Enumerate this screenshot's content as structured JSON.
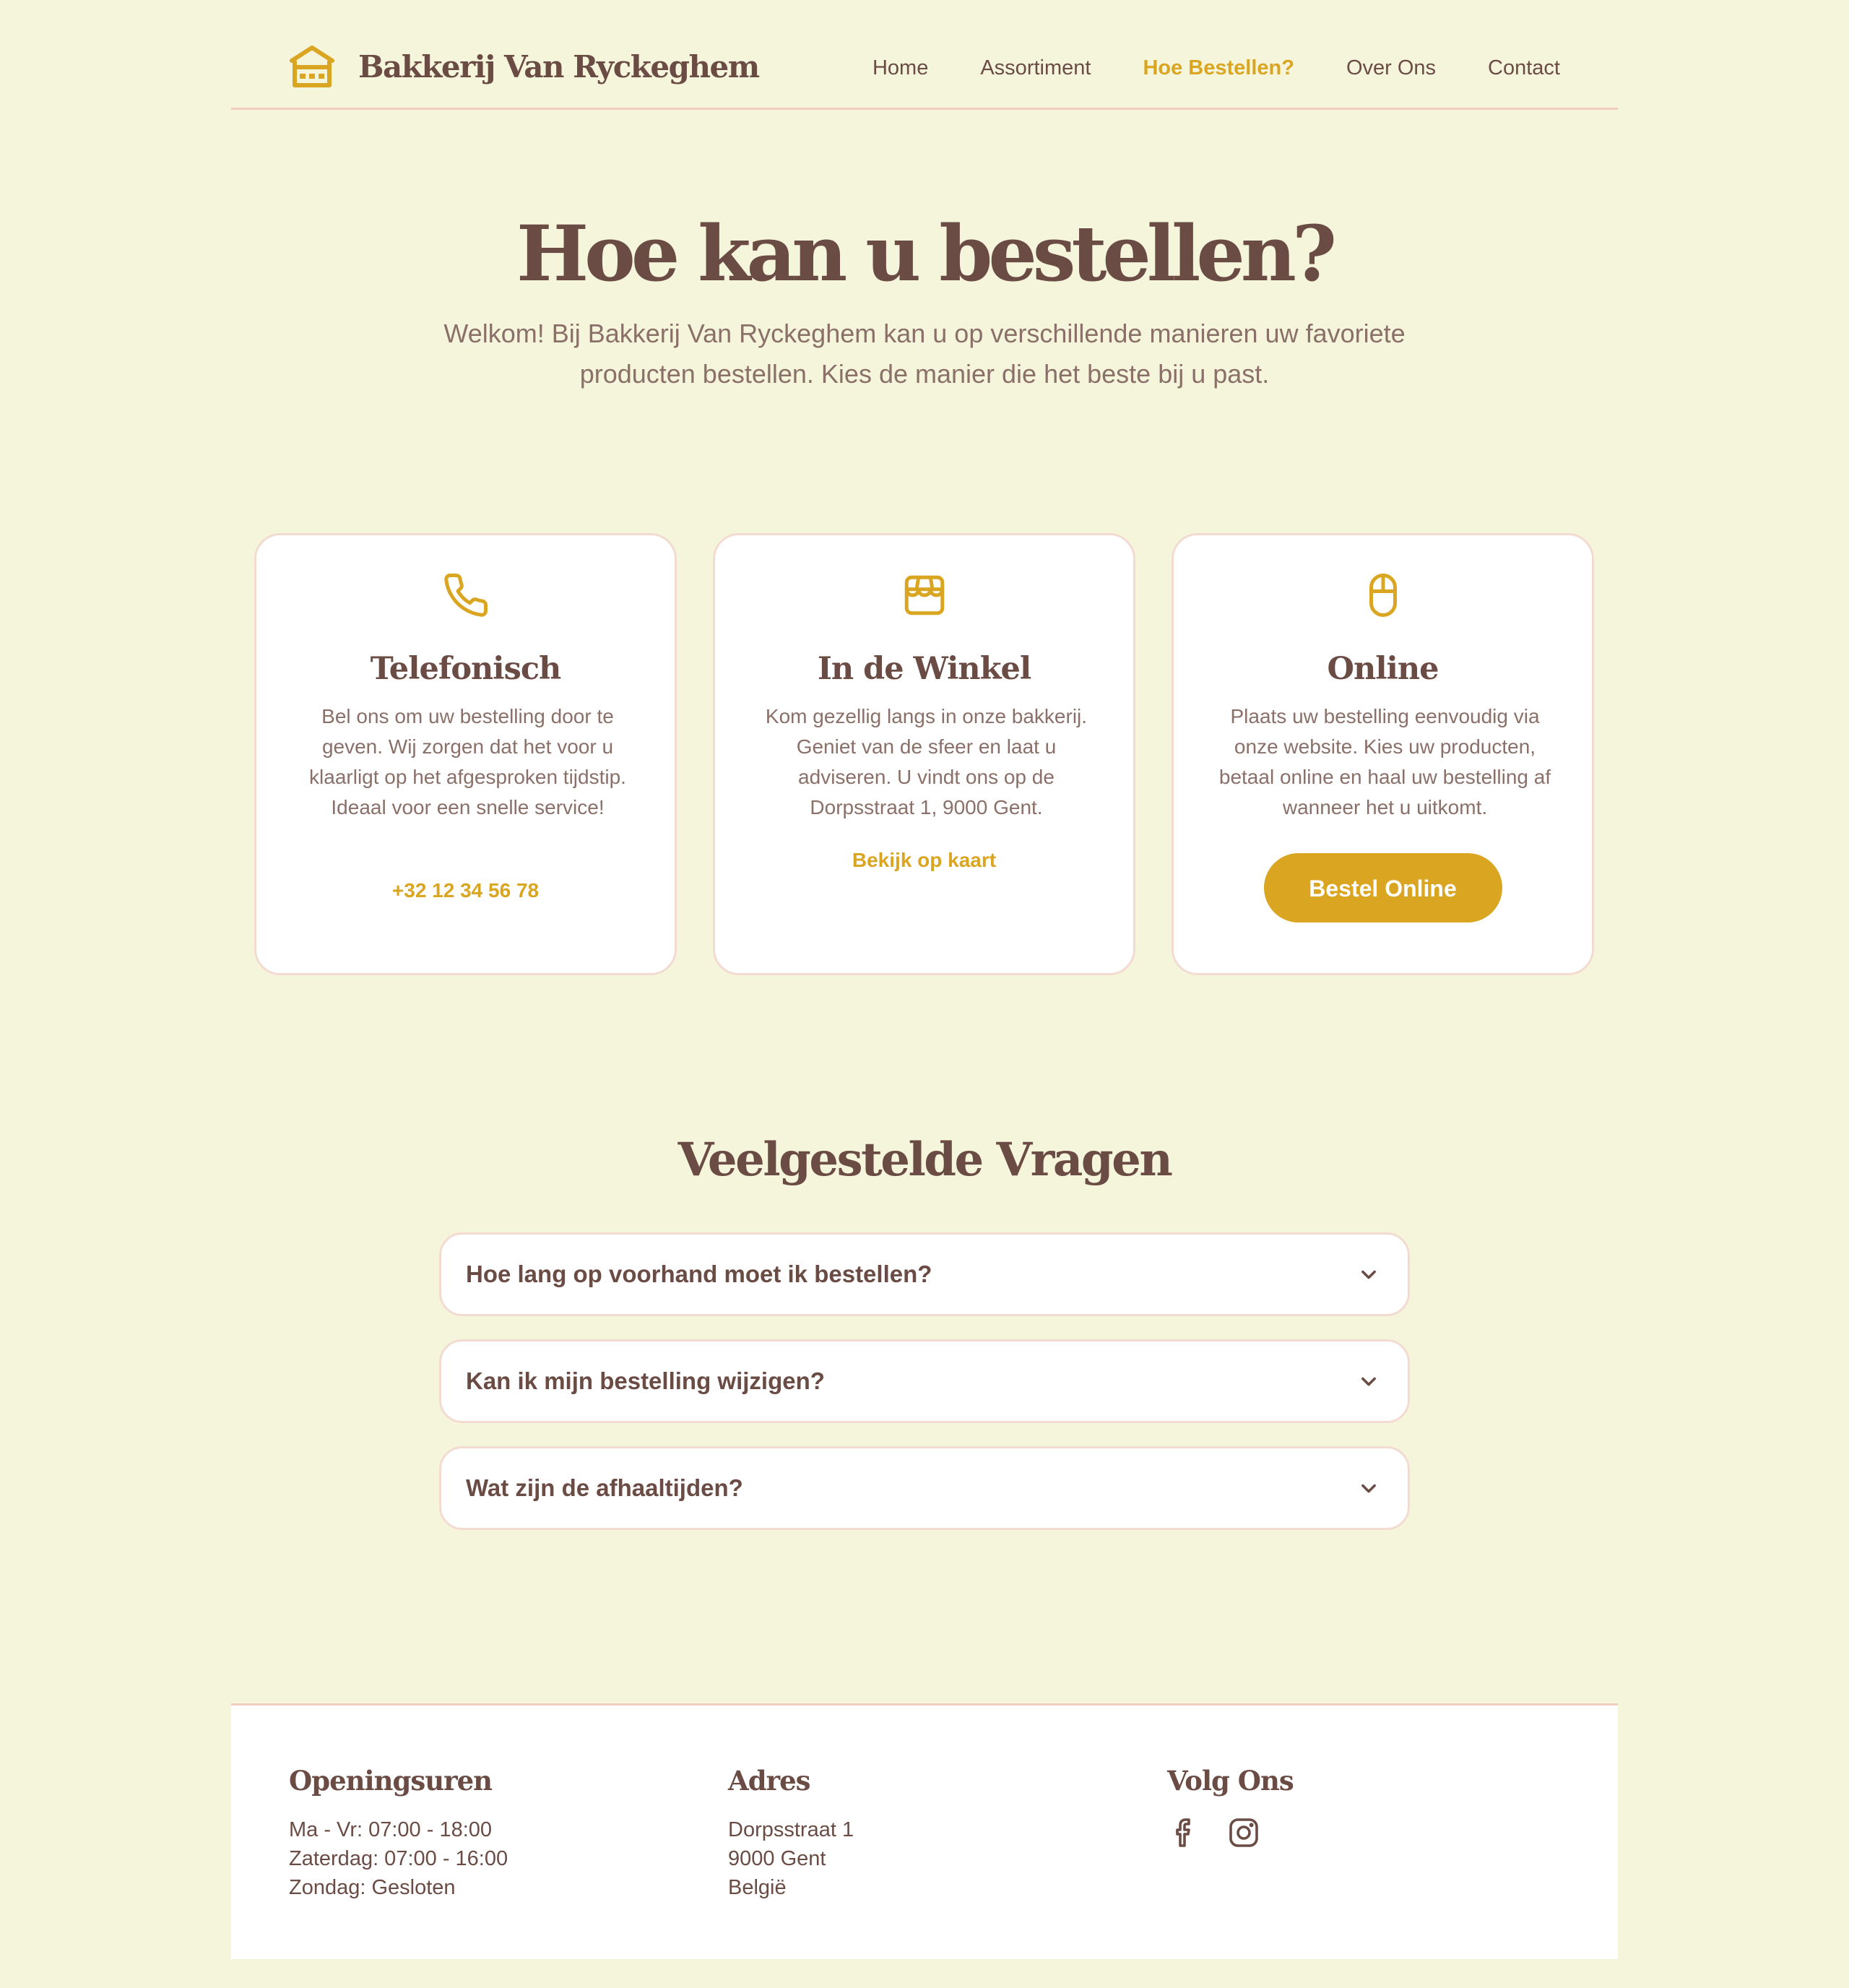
{
  "brand": {
    "name": "Bakkerij Van Ryckeghem",
    "icon": "bakery-store-icon",
    "accent_color": "#daa520",
    "text_color": "#6b4c45",
    "background_color": "#f5f5dc"
  },
  "nav": {
    "items": [
      {
        "label": "Home",
        "active": false
      },
      {
        "label": "Assortiment",
        "active": false
      },
      {
        "label": "Hoe Bestellen?",
        "active": true
      },
      {
        "label": "Over Ons",
        "active": false
      },
      {
        "label": "Contact",
        "active": false
      }
    ]
  },
  "hero": {
    "title": "Hoe kan u bestellen?",
    "subtitle": "Welkom! Bij Bakkerij Van Ryckeghem kan u op verschillende manieren uw favoriete producten bestellen. Kies de manier die het beste bij u past."
  },
  "cards": [
    {
      "icon": "phone-icon",
      "title": "Telefonisch",
      "text": "Bel ons om uw bestelling door te geven. Wij zorgen dat het voor u klaarligt op het afgesproken tijdstip. Ideaal voor een snelle service!",
      "link": "+32 12 34 56 78"
    },
    {
      "icon": "store-icon",
      "title": "In de Winkel",
      "text": "Kom gezellig langs in onze bakkerij. Geniet van de sfeer en laat u adviseren. U vindt ons op de Dorpsstraat 1, 9000 Gent.",
      "link": "Bekijk op kaart"
    },
    {
      "icon": "mouse-icon",
      "title": "Online",
      "text": "Plaats uw bestelling eenvoudig via onze website. Kies uw producten, betaal online en haal uw bestelling af wanneer het u uitkomt.",
      "button": "Bestel Online"
    }
  ],
  "faq": {
    "title": "Veelgestelde Vragen",
    "items": [
      {
        "question": "Hoe lang op voorhand moet ik bestellen?"
      },
      {
        "question": "Kan ik mijn bestelling wijzigen?"
      },
      {
        "question": "Wat zijn de afhaaltijden?"
      }
    ]
  },
  "footer": {
    "hours": {
      "heading": "Openingsuren",
      "lines": [
        "Ma - Vr: 07:00 - 18:00",
        "Zaterdag: 07:00 - 16:00",
        "Zondag: Gesloten"
      ]
    },
    "address": {
      "heading": "Adres",
      "lines": [
        "Dorpsstraat 1",
        "9000 Gent",
        "België"
      ]
    },
    "social": {
      "heading": "Volg Ons",
      "icons": [
        "facebook-icon",
        "instagram-icon"
      ]
    }
  }
}
